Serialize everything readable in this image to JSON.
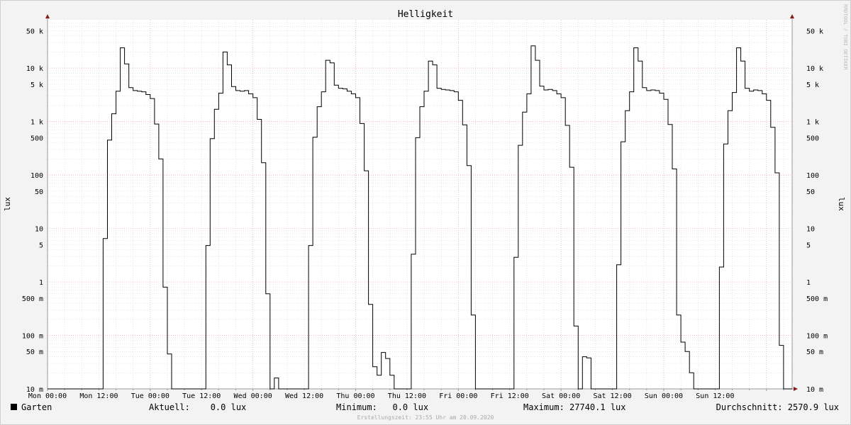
{
  "chart_data": {
    "type": "line",
    "title": "Helligkeit",
    "ylabel_left": "lux",
    "ylabel_right": "lux",
    "y_scale": "log",
    "ylim": [
      0.01,
      80000
    ],
    "y_ticks": [
      {
        "v": 50000,
        "label": "50 k"
      },
      {
        "v": 10000,
        "label": "10 k"
      },
      {
        "v": 5000,
        "label": "5 k"
      },
      {
        "v": 1000,
        "label": "1 k"
      },
      {
        "v": 500,
        "label": "500"
      },
      {
        "v": 100,
        "label": "100"
      },
      {
        "v": 50,
        "label": "50"
      },
      {
        "v": 10,
        "label": "10"
      },
      {
        "v": 5,
        "label": "5"
      },
      {
        "v": 1,
        "label": "1"
      },
      {
        "v": 0.5,
        "label": "500 m"
      },
      {
        "v": 0.1,
        "label": "100 m"
      },
      {
        "v": 0.05,
        "label": "50 m"
      },
      {
        "v": 0.01,
        "label": "10 m"
      }
    ],
    "x_ticks": [
      "Mon 00:00",
      "Mon 12:00",
      "Tue 00:00",
      "Tue 12:00",
      "Wed 00:00",
      "Wed 12:00",
      "Thu 00:00",
      "Thu 12:00",
      "Fri 00:00",
      "Fri 12:00",
      "Sat 00:00",
      "Sat 12:00",
      "Sun 00:00",
      "Sun 12:00"
    ],
    "grid": true,
    "series": [
      {
        "name": "Garten",
        "color": "#000000",
        "points": [
          [
            0.0,
            0.01
          ],
          [
            6.5,
            0.01
          ],
          [
            6.5,
            6.5
          ],
          [
            7.0,
            6.5
          ],
          [
            7.0,
            450
          ],
          [
            7.5,
            450
          ],
          [
            7.5,
            1400
          ],
          [
            8.0,
            1400
          ],
          [
            8.0,
            3700
          ],
          [
            8.5,
            3700
          ],
          [
            8.5,
            24000
          ],
          [
            9.0,
            24000
          ],
          [
            9.0,
            12000
          ],
          [
            9.5,
            12000
          ],
          [
            9.5,
            4300
          ],
          [
            10.0,
            4300
          ],
          [
            10.0,
            3800
          ],
          [
            10.5,
            3800
          ],
          [
            10.5,
            3700
          ],
          [
            11.0,
            3700
          ],
          [
            11.0,
            3600
          ],
          [
            11.5,
            3600
          ],
          [
            11.5,
            3200
          ],
          [
            12.0,
            3200
          ],
          [
            12.0,
            2700
          ],
          [
            12.5,
            2700
          ],
          [
            12.5,
            900
          ],
          [
            13.0,
            900
          ],
          [
            13.0,
            200
          ],
          [
            13.5,
            200
          ],
          [
            13.5,
            0.8
          ],
          [
            14.0,
            0.8
          ],
          [
            14.0,
            0.045
          ],
          [
            14.5,
            0.045
          ],
          [
            14.5,
            0.01
          ],
          [
            18.5,
            0.01
          ],
          [
            18.5,
            4.8
          ],
          [
            19.0,
            4.8
          ],
          [
            19.0,
            480
          ],
          [
            19.5,
            480
          ],
          [
            19.5,
            1700
          ],
          [
            20.0,
            1700
          ],
          [
            20.0,
            3400
          ],
          [
            20.5,
            3400
          ],
          [
            20.5,
            20000
          ],
          [
            21.0,
            20000
          ],
          [
            21.0,
            11500
          ],
          [
            21.5,
            11500
          ],
          [
            21.5,
            4500
          ],
          [
            22.0,
            4500
          ],
          [
            22.0,
            3800
          ],
          [
            22.5,
            3800
          ],
          [
            22.5,
            3700
          ],
          [
            23.0,
            3700
          ],
          [
            23.0,
            3800
          ],
          [
            23.5,
            3800
          ],
          [
            23.5,
            3300
          ],
          [
            24.0,
            3300
          ],
          [
            24.0,
            2800
          ],
          [
            24.5,
            2800
          ],
          [
            24.5,
            1100
          ],
          [
            25.0,
            1100
          ],
          [
            25.0,
            170
          ],
          [
            25.5,
            170
          ],
          [
            25.5,
            0.6
          ],
          [
            26.0,
            0.6
          ],
          [
            26.0,
            0.01
          ],
          [
            26.5,
            0.01
          ],
          [
            26.5,
            0.016
          ],
          [
            27.0,
            0.016
          ],
          [
            27.0,
            0.01
          ],
          [
            30.5,
            0.01
          ],
          [
            30.5,
            4.8
          ],
          [
            31.0,
            4.8
          ],
          [
            31.0,
            510
          ],
          [
            31.5,
            510
          ],
          [
            31.5,
            1900
          ],
          [
            32.0,
            1900
          ],
          [
            32.0,
            3600
          ],
          [
            32.5,
            3600
          ],
          [
            32.5,
            14000
          ],
          [
            33.0,
            14000
          ],
          [
            33.0,
            12500
          ],
          [
            33.5,
            12500
          ],
          [
            33.5,
            4800
          ],
          [
            34.0,
            4800
          ],
          [
            34.0,
            4200
          ],
          [
            34.5,
            4200
          ],
          [
            34.5,
            4100
          ],
          [
            35.0,
            4100
          ],
          [
            35.0,
            3700
          ],
          [
            35.5,
            3700
          ],
          [
            35.5,
            3300
          ],
          [
            36.0,
            3300
          ],
          [
            36.0,
            2800
          ],
          [
            36.5,
            2800
          ],
          [
            36.5,
            920
          ],
          [
            37.0,
            920
          ],
          [
            37.0,
            120
          ],
          [
            37.5,
            120
          ],
          [
            37.5,
            0.38
          ],
          [
            38.0,
            0.38
          ],
          [
            38.0,
            0.026
          ],
          [
            38.5,
            0.026
          ],
          [
            38.5,
            0.018
          ],
          [
            39.0,
            0.018
          ],
          [
            39.0,
            0.048
          ],
          [
            39.5,
            0.048
          ],
          [
            39.5,
            0.037
          ],
          [
            40.0,
            0.037
          ],
          [
            40.0,
            0.018
          ],
          [
            40.5,
            0.018
          ],
          [
            40.5,
            0.01
          ],
          [
            42.5,
            0.01
          ],
          [
            42.5,
            3.3
          ],
          [
            43.0,
            3.3
          ],
          [
            43.0,
            500
          ],
          [
            43.5,
            500
          ],
          [
            43.5,
            1900
          ],
          [
            44.0,
            1900
          ],
          [
            44.0,
            3700
          ],
          [
            44.5,
            3700
          ],
          [
            44.5,
            13500
          ],
          [
            45.0,
            13500
          ],
          [
            45.0,
            11500
          ],
          [
            45.5,
            11500
          ],
          [
            45.5,
            4200
          ],
          [
            46.0,
            4200
          ],
          [
            46.0,
            4000
          ],
          [
            46.5,
            4000
          ],
          [
            46.5,
            3900
          ],
          [
            47.0,
            3900
          ],
          [
            47.0,
            3800
          ],
          [
            47.5,
            3800
          ],
          [
            47.5,
            3600
          ],
          [
            48.0,
            3600
          ],
          [
            48.0,
            2500
          ],
          [
            48.5,
            2500
          ],
          [
            48.5,
            870
          ],
          [
            49.0,
            870
          ],
          [
            49.0,
            150
          ],
          [
            49.5,
            150
          ],
          [
            49.5,
            0.24
          ],
          [
            50.0,
            0.24
          ],
          [
            50.0,
            0.01
          ],
          [
            54.5,
            0.01
          ],
          [
            54.5,
            2.9
          ],
          [
            55.0,
            2.9
          ],
          [
            55.0,
            360
          ],
          [
            55.5,
            360
          ],
          [
            55.5,
            1500
          ],
          [
            56.0,
            1500
          ],
          [
            56.0,
            3300
          ],
          [
            56.5,
            3300
          ],
          [
            56.5,
            26000
          ],
          [
            57.0,
            26000
          ],
          [
            57.0,
            14000
          ],
          [
            57.5,
            14000
          ],
          [
            57.5,
            4600
          ],
          [
            58.0,
            4600
          ],
          [
            58.0,
            3900
          ],
          [
            58.5,
            3900
          ],
          [
            58.5,
            4000
          ],
          [
            59.0,
            4000
          ],
          [
            59.0,
            3800
          ],
          [
            59.5,
            3800
          ],
          [
            59.5,
            3300
          ],
          [
            60.0,
            3300
          ],
          [
            60.0,
            2800
          ],
          [
            60.5,
            2800
          ],
          [
            60.5,
            850
          ],
          [
            61.0,
            850
          ],
          [
            61.0,
            140
          ],
          [
            61.5,
            140
          ],
          [
            61.5,
            0.15
          ],
          [
            62.0,
            0.15
          ],
          [
            62.0,
            0.01
          ],
          [
            62.5,
            0.01
          ],
          [
            62.5,
            0.04
          ],
          [
            63.0,
            0.04
          ],
          [
            63.0,
            0.038
          ],
          [
            63.5,
            0.038
          ],
          [
            63.5,
            0.01
          ],
          [
            66.5,
            0.01
          ],
          [
            66.5,
            2.1
          ],
          [
            67.0,
            2.1
          ],
          [
            67.0,
            420
          ],
          [
            67.5,
            420
          ],
          [
            67.5,
            1600
          ],
          [
            68.0,
            1600
          ],
          [
            68.0,
            3600
          ],
          [
            68.5,
            3600
          ],
          [
            68.5,
            24000
          ],
          [
            69.0,
            24000
          ],
          [
            69.0,
            13500
          ],
          [
            69.5,
            13500
          ],
          [
            69.5,
            4300
          ],
          [
            70.0,
            4300
          ],
          [
            70.0,
            3800
          ],
          [
            70.5,
            3800
          ],
          [
            70.5,
            3900
          ],
          [
            71.0,
            3900
          ],
          [
            71.0,
            3800
          ],
          [
            71.5,
            3800
          ],
          [
            71.5,
            3400
          ],
          [
            72.0,
            3400
          ],
          [
            72.0,
            2600
          ],
          [
            72.5,
            2600
          ],
          [
            72.5,
            880
          ],
          [
            73.0,
            880
          ],
          [
            73.0,
            130
          ],
          [
            73.5,
            130
          ],
          [
            73.5,
            0.24
          ],
          [
            74.0,
            0.24
          ],
          [
            74.0,
            0.075
          ],
          [
            74.5,
            0.075
          ],
          [
            74.5,
            0.05
          ],
          [
            75.0,
            0.05
          ],
          [
            75.0,
            0.02
          ],
          [
            75.5,
            0.02
          ],
          [
            75.5,
            0.01
          ],
          [
            78.5,
            0.01
          ],
          [
            78.5,
            1.9
          ],
          [
            79.0,
            1.9
          ],
          [
            79.0,
            380
          ],
          [
            79.5,
            380
          ],
          [
            79.5,
            1600
          ],
          [
            80.0,
            1600
          ],
          [
            80.0,
            3500
          ],
          [
            80.5,
            3500
          ],
          [
            80.5,
            24000
          ],
          [
            81.0,
            24000
          ],
          [
            81.0,
            13500
          ],
          [
            81.5,
            13500
          ],
          [
            81.5,
            4200
          ],
          [
            82.0,
            4200
          ],
          [
            82.0,
            3700
          ],
          [
            82.5,
            3700
          ],
          [
            82.5,
            3900
          ],
          [
            83.0,
            3900
          ],
          [
            83.0,
            3800
          ],
          [
            83.5,
            3800
          ],
          [
            83.5,
            3300
          ],
          [
            84.0,
            3300
          ],
          [
            84.0,
            2500
          ],
          [
            84.5,
            2500
          ],
          [
            84.5,
            780
          ],
          [
            85.0,
            780
          ],
          [
            85.0,
            110
          ],
          [
            85.5,
            110
          ],
          [
            85.5,
            0.065
          ],
          [
            86.0,
            0.065
          ],
          [
            86.0,
            0.01
          ],
          [
            87.0,
            0.01
          ]
        ]
      }
    ]
  },
  "legend": {
    "label": "Garten",
    "swatch_color": "#000000",
    "aktuell": "Aktuell:    0.0 lux",
    "minimum": "Minimum:   0.0 lux",
    "maximum": "Maximum: 27740.1 lux",
    "durchschnitt": "Durchschnitt: 2570.9 lux"
  },
  "footer": {
    "created": "Erstellungszeit: 23:55 Uhr am 20.09.2020",
    "watermark": "RRDTOOL / TOBI OETIKER"
  },
  "colors": {
    "background": "#f3f3f3",
    "plot_background": "#ffffff",
    "major_grid": "#e8a0a0",
    "minor_grid": "#d6d6d6",
    "axis_arrow": "#8b1a1a"
  }
}
